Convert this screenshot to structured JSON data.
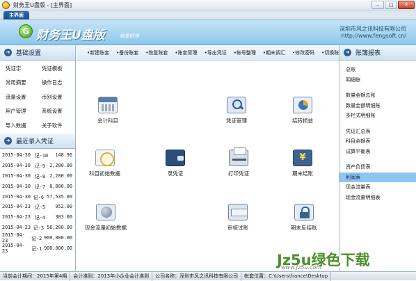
{
  "window": {
    "title": "财务王U盘版 - [主界面]",
    "tab": "主界面",
    "minimize_glyph": "–",
    "maximize_glyph": "□",
    "close_glyph": "✕"
  },
  "header": {
    "logo_letter": "G",
    "brand": "财务王U盘版",
    "slogan": "就是好用",
    "company": "深圳市风之讯科技有限公司",
    "website": "http://www.fengsoft.cn/"
  },
  "left": {
    "basic_title": "基础设置",
    "basic_items": [
      "凭证字",
      "凭证模板",
      "常用摘要",
      "操作日志",
      "流量设置",
      "币别设置",
      "用户管理",
      "系统设置",
      "导入数据",
      "关于软件"
    ],
    "recent_title": "最近录入凭证",
    "recent": [
      {
        "date": "2015-04-30",
        "voucher": "记-10",
        "amount": "148.96"
      },
      {
        "date": "2015-04-30",
        "voucher": "记-9",
        "amount": "2,200.00"
      },
      {
        "date": "2015-04-30",
        "voucher": "记-8",
        "amount": "2,200.00"
      },
      {
        "date": "2015-04-30",
        "voucher": "记-7",
        "amount": "8,000.00"
      },
      {
        "date": "2015-04-30",
        "voucher": "记-6",
        "amount": "57,535.00"
      },
      {
        "date": "2015-04-23",
        "voucher": "记-5",
        "amount": "952.00"
      },
      {
        "date": "2015-04-23",
        "voucher": "记-4",
        "amount": "383.00"
      },
      {
        "date": "2015-04-23",
        "voucher": "记-3",
        "amount": "56,200.00"
      },
      {
        "date": "2015-04-23",
        "voucher": "记-2",
        "amount": "900,000.00"
      },
      {
        "date": "2015-04-23",
        "voucher": "记-1",
        "amount": "900,000.00"
      }
    ]
  },
  "toolbar": [
    "•新建账套",
    "•备份账套",
    "•恢复账套",
    "•账套管理",
    "•导出凭证",
    "•帐号整理",
    "•期末调汇",
    "•修改密码",
    "•切换账套"
  ],
  "functions": {
    "account_subject": "会计科目",
    "voucher_manage": "凭证管理",
    "carry_profit": "结转损益",
    "subject_initial": "科目初始数据",
    "enter_voucher": "录凭证",
    "print_voucher": "打印凭证",
    "period_close": "期末结账",
    "cashflow_initial": "现金流量初始数据",
    "audit_post": "审核过账",
    "reverse_close": "期末反结账"
  },
  "right": {
    "title": "账簿报表",
    "groups": [
      [
        "总账",
        "明细账"
      ],
      [
        "数量金额总账",
        "数量金额明细账",
        "多栏式明细账"
      ],
      [
        "凭证汇总表",
        "科目余额表",
        "试算平衡表"
      ],
      [
        "资产负债表",
        "利润表",
        "现金流量表",
        "现金流量明细表"
      ]
    ],
    "selected": "利润表"
  },
  "status": {
    "period": "当前会计期间：2015年第4期",
    "standard": "会计准则：2013年小企业会计准则",
    "company": "公司名称：深圳市风之讯科技有限公司",
    "location": "帐套位置：C:\\Users\\france\\Desktop"
  },
  "watermark": {
    "main": "Jz5u绿色下载",
    "url": "www.Jz5u.com"
  },
  "colors": {
    "header_bg": "#8ec7ec",
    "accent": "#174d8c",
    "selected_row": "#8fc6ef",
    "watermark": "#4d8e2a"
  }
}
